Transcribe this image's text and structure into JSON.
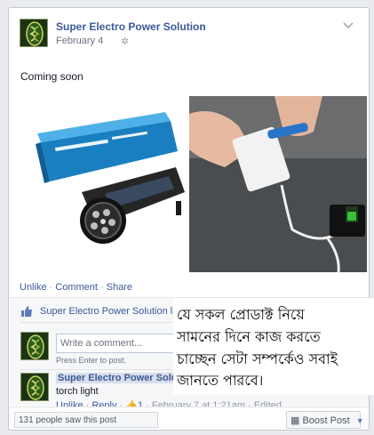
{
  "post": {
    "page_name": "Super Electro Power Solution",
    "date": "February 4",
    "audience_icon": "gear-icon",
    "text": "Coming soon",
    "images": [
      "solar-torch-product-photo",
      "power-bank-charging-photo"
    ]
  },
  "actions": {
    "unlike": "Unlike",
    "comment": "Comment",
    "share": "Share"
  },
  "likes": {
    "text": "Super Electro Power Solution like"
  },
  "comment_box": {
    "placeholder": "Write a comment...",
    "hint": "Press Enter to post."
  },
  "comment": {
    "author": "Super Electro Power Solution",
    "text": "torch light",
    "unlike": "Unlike",
    "reply": "Reply",
    "like_count": "1",
    "timestamp": "February 7 at 1:21am",
    "edited": "Edited"
  },
  "footer": {
    "seen": "131 people saw this post",
    "boost": "Boost Post"
  },
  "overlay": {
    "lines": [
      "যে সকল প্রোডাক্ট নিয়ে",
      "সামনের দিনে কাজ করতে",
      "চাচ্ছেন সেটা সম্পর্কেও সবাই",
      "জানতে পারবে।"
    ]
  },
  "colors": {
    "link": "#3b5998",
    "muted": "#9197a3",
    "feedback_bg": "#f6f7f9"
  }
}
